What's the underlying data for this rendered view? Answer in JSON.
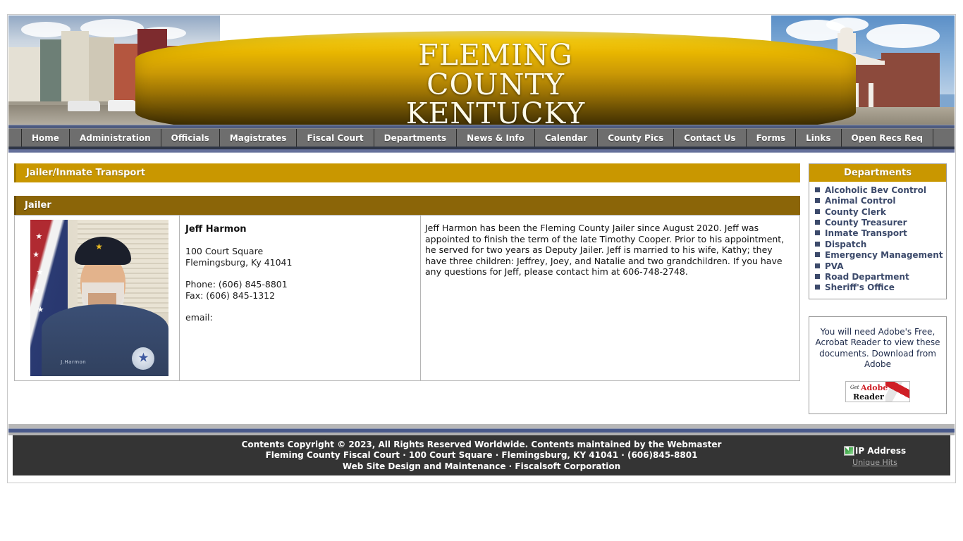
{
  "banner": {
    "title": "FLEMING\nCOUNTY\nKENTUCKY",
    "left_photo_alt": "Historic downtown Flemingsburg street",
    "right_photo_alt": "Fleming County Courthouse"
  },
  "nav": {
    "items": [
      {
        "label": "Home"
      },
      {
        "label": "Administration"
      },
      {
        "label": "Officials"
      },
      {
        "label": "Magistrates"
      },
      {
        "label": "Fiscal Court"
      },
      {
        "label": "Departments"
      },
      {
        "label": "News & Info"
      },
      {
        "label": "Calendar"
      },
      {
        "label": "County Pics"
      },
      {
        "label": "Contact Us"
      },
      {
        "label": "Forms"
      },
      {
        "label": "Links"
      },
      {
        "label": "Open Recs Req"
      }
    ]
  },
  "main": {
    "page_title": "Jailer/Inmate Transport",
    "section_title": "Jailer",
    "official": {
      "photo_alt": "Jeff Harmon portrait",
      "name": "Jeff Harmon",
      "address_line1": "100 Court Square",
      "address_line2": "Flemingsburg, Ky 41041",
      "phone": "Phone: (606) 845-8801",
      "fax": "Fax: (606) 845-1312",
      "email_label": "email:",
      "bio": "Jeff Harmon has been the Fleming County Jailer since August 2020. Jeff was appointed to finish the term of the late Timothy Cooper. Prior to his appointment, he served for two years as Deputy Jailer. Jeff is married to his wife, Kathy; they have three children: Jeffrey, Joey, and Natalie and two grandchildren. If you have any questions for Jeff, please contact him at 606-748-2748."
    }
  },
  "sidebar": {
    "departments_header": "Departments",
    "departments": [
      {
        "label": "Alcoholic Bev Control"
      },
      {
        "label": "Animal Control"
      },
      {
        "label": "County Clerk"
      },
      {
        "label": "County Treasurer"
      },
      {
        "label": "Inmate Transport"
      },
      {
        "label": "Dispatch"
      },
      {
        "label": "Emergency Management"
      },
      {
        "label": "PVA"
      },
      {
        "label": "Road Department"
      },
      {
        "label": "Sheriff's Office"
      }
    ],
    "adobe": {
      "text": "You will need Adobe's Free, Acrobat Reader to view these documents. Download from Adobe",
      "button_get": "Get",
      "button_adobe": "Adobe",
      "button_reader": "Reader"
    }
  },
  "footer": {
    "text": "Contents Copyright © 2023, All Rights Reserved Worldwide. Contents maintained by the Webmaster\nFleming County Fiscal Court · 100 Court Square · Flemingsburg, KY 41041 · (606)845-8801\nWeb Site Design and Maintenance · Fiscalsoft Corporation",
    "ip_image_alt": "IP Address",
    "unique_hits_label": "Unique Hits"
  },
  "colors": {
    "gold": "#c99700",
    "dark_gold": "#8b6508",
    "nav_gray": "#6e6e6e",
    "nav_blue": "#49598a",
    "footer_dark": "#343434",
    "dept_text": "#3c4a6b"
  }
}
